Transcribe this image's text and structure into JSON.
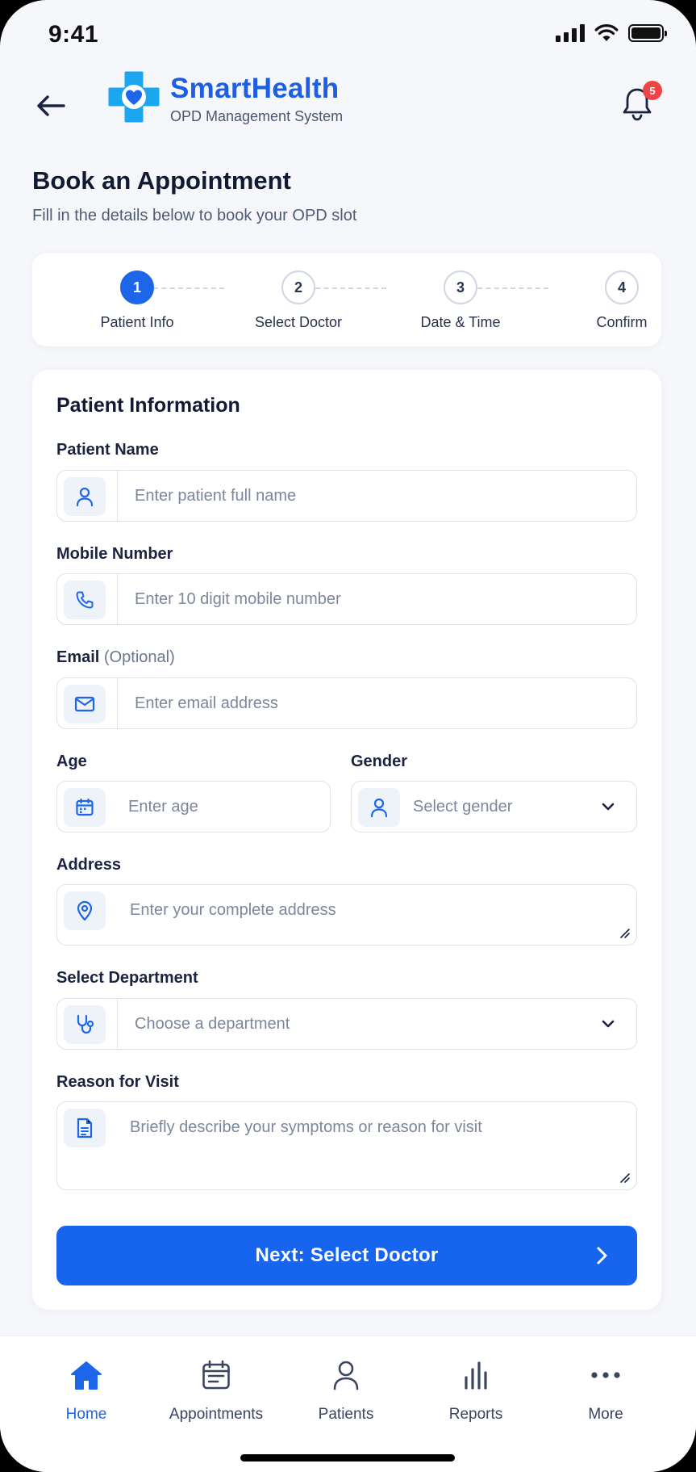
{
  "status_bar": {
    "time": "9:41"
  },
  "header": {
    "brand_title": "SmartHealth",
    "brand_subtitle": "OPD Management System",
    "notification_count": "5"
  },
  "page": {
    "title": "Book an Appointment",
    "subtitle": "Fill in the details below to book your OPD slot"
  },
  "stepper": {
    "steps": [
      {
        "number": "1",
        "label": "Patient Info",
        "active": true
      },
      {
        "number": "2",
        "label": "Select Doctor",
        "active": false
      },
      {
        "number": "3",
        "label": "Date & Time",
        "active": false
      },
      {
        "number": "4",
        "label": "Confirm",
        "active": false
      }
    ]
  },
  "form": {
    "title": "Patient Information",
    "patient_name": {
      "label": "Patient Name",
      "placeholder": "Enter patient full name",
      "icon": "user-icon"
    },
    "mobile": {
      "label": "Mobile Number",
      "placeholder": "Enter 10 digit mobile number",
      "icon": "phone-icon"
    },
    "email": {
      "label": "Email",
      "label_note": "(Optional)",
      "placeholder": "Enter email address",
      "icon": "mail-icon"
    },
    "age": {
      "label": "Age",
      "placeholder": "Enter age",
      "icon": "calendar-icon"
    },
    "gender": {
      "label": "Gender",
      "placeholder": "Select gender",
      "icon": "user-icon"
    },
    "address": {
      "label": "Address",
      "placeholder": "Enter your complete address",
      "icon": "location-pin-icon"
    },
    "department": {
      "label": "Select Department",
      "placeholder": "Choose a department",
      "icon": "stethoscope-icon"
    },
    "reason": {
      "label": "Reason for Visit",
      "placeholder": "Briefly describe your symptoms or reason for visit",
      "icon": "document-icon"
    },
    "next_button": "Next: Select Doctor"
  },
  "bottom_nav": {
    "items": [
      {
        "label": "Home",
        "icon": "home-icon",
        "active": true
      },
      {
        "label": "Appointments",
        "icon": "calendar-icon",
        "active": false
      },
      {
        "label": "Patients",
        "icon": "user-icon",
        "active": false
      },
      {
        "label": "Reports",
        "icon": "bar-chart-icon",
        "active": false
      },
      {
        "label": "More",
        "icon": "more-dots-icon",
        "active": false
      }
    ]
  },
  "colors": {
    "accent": "#1d66ea",
    "badge": "#ef4444",
    "background": "#f6f7fb"
  }
}
